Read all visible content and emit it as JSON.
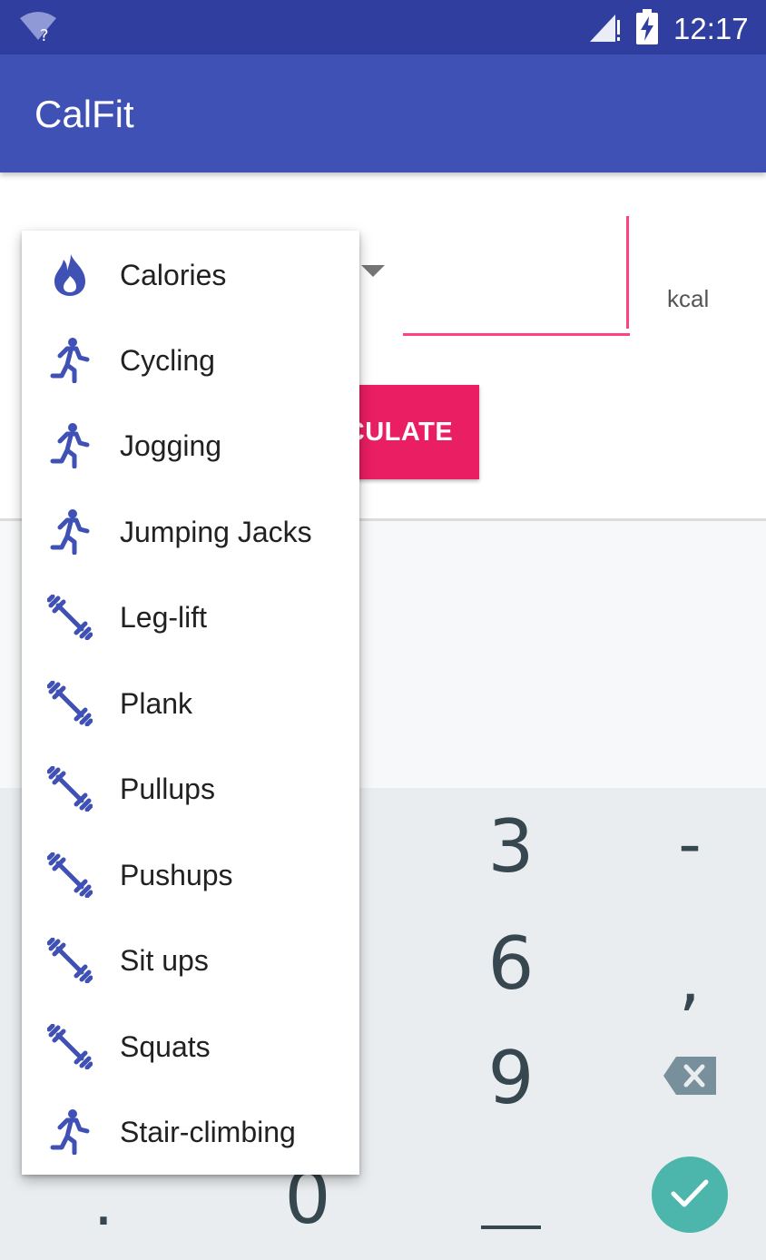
{
  "status_bar": {
    "time": "12:17"
  },
  "app_bar": {
    "title": "CalFit"
  },
  "form": {
    "unit": "kcal",
    "calculate_label": "CULATE"
  },
  "dropdown": {
    "items": [
      {
        "label": "Calories",
        "icon": "flame-icon"
      },
      {
        "label": "Cycling",
        "icon": "run-icon"
      },
      {
        "label": "Jogging",
        "icon": "run-icon"
      },
      {
        "label": "Jumping Jacks",
        "icon": "run-icon"
      },
      {
        "label": "Leg-lift",
        "icon": "dumbbell-icon"
      },
      {
        "label": "Plank",
        "icon": "dumbbell-icon"
      },
      {
        "label": "Pullups",
        "icon": "dumbbell-icon"
      },
      {
        "label": "Pushups",
        "icon": "dumbbell-icon"
      },
      {
        "label": "Sit ups",
        "icon": "dumbbell-icon"
      },
      {
        "label": "Squats",
        "icon": "dumbbell-icon"
      },
      {
        "label": "Stair-climbing",
        "icon": "run-icon"
      }
    ]
  },
  "keypad": {
    "key_3": "3",
    "key_6": "6",
    "key_9": "9",
    "key_0": "0",
    "key_minus": "-",
    "key_comma": ",",
    "key_dot": "."
  },
  "colors": {
    "status_bar": "#303f9f",
    "app_bar": "#3f51b5",
    "accent": "#e91e63",
    "edit_underline": "#ff4081",
    "icon": "#3f51b5",
    "done_key": "#4db6ac"
  }
}
